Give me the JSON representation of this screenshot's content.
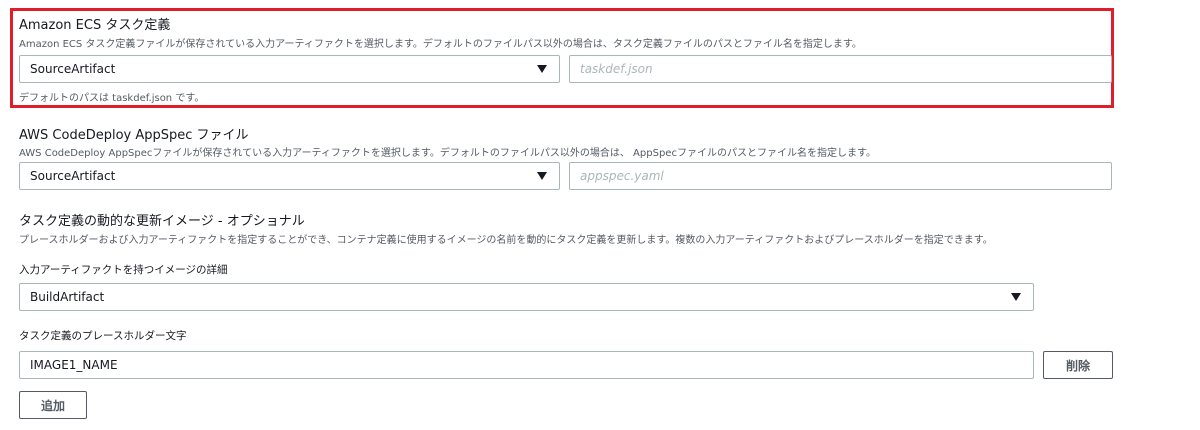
{
  "ecs_task_definition": {
    "label": "Amazon ECS タスク定義",
    "description": "Amazon ECS タスク定義ファイルが保存されている入力アーティファクトを選択します。デフォルトのファイルパス以外の場合は、タスク定義ファイルのパスとファイル名を指定します。",
    "artifact_value": "SourceArtifact",
    "path_placeholder": "taskdef.json",
    "helper": "デフォルトのパスは taskdef.json です。"
  },
  "codedeploy_appspec": {
    "label": "AWS CodeDeploy AppSpec ファイル",
    "description": "AWS CodeDeploy AppSpecファイルが保存されている入力アーティファクトを選択します。デフォルトのファイルパス以外の場合は、 AppSpecファイルのパスとファイル名を指定します。",
    "artifact_value": "SourceArtifact",
    "path_placeholder": "appspec.yaml"
  },
  "dynamic_image": {
    "title": "タスク定義の動的な更新イメージ - オプショナル",
    "description": "プレースホルダーおよび入力アーティファクトを指定することができ、コンテナ定義に使用するイメージの名前を動的にタスク定義を更新します。複数の入力アーティファクトおよびプレースホルダーを指定できます。",
    "image_details_label": "入力アーティファクトを持つイメージの詳細",
    "image_details_value": "BuildArtifact",
    "placeholder_label": "タスク定義のプレースホルダー文字",
    "placeholder_value": "IMAGE1_NAME",
    "remove_label": "削除",
    "add_label": "追加"
  },
  "colors": {
    "highlight": "#e01e2b",
    "border": "#aab7b8",
    "text": "#16191f",
    "muted": "#545b64"
  }
}
